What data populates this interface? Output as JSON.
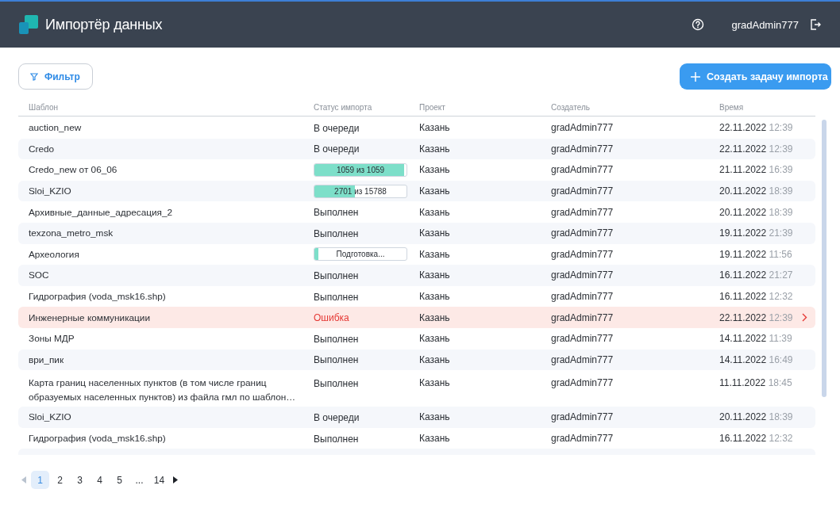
{
  "header": {
    "title": "Импортёр данных",
    "user": "gradAdmin777"
  },
  "toolbar": {
    "filter": "Фильтр",
    "create": "Создать задачу импорта"
  },
  "table": {
    "columns": [
      "Шаблон",
      "Статус импорта",
      "Проект",
      "Создатель",
      "Время"
    ],
    "rows": [
      {
        "template": "auction_new",
        "status": {
          "kind": "text",
          "label": "В очереди"
        },
        "project": "Казань",
        "creator": "gradAdmin777",
        "date": "22.11.2022",
        "time": "12:39",
        "selected": false
      },
      {
        "template": "Credo",
        "status": {
          "kind": "text",
          "label": "В очереди"
        },
        "project": "Казань",
        "creator": "gradAdmin777",
        "date": "22.11.2022",
        "time": "12:39",
        "selected": false
      },
      {
        "template": "Credo_new от 06_06",
        "status": {
          "kind": "progress",
          "label": "1059 из 1059",
          "level": 0.97
        },
        "project": "Казань",
        "creator": "gradAdmin777",
        "date": "21.11.2022",
        "time": "16:39",
        "selected": false
      },
      {
        "template": "Sloi_KZIO",
        "status": {
          "kind": "progress",
          "label": "2701 из 15788",
          "level": 0.44
        },
        "project": "Казань",
        "creator": "gradAdmin777",
        "date": "20.11.2022",
        "time": "18:39",
        "selected": false
      },
      {
        "template": "Архивные_данные_адресация_2",
        "status": {
          "kind": "text",
          "label": "Выполнен"
        },
        "project": "Казань",
        "creator": "gradAdmin777",
        "date": "20.11.2022",
        "time": "18:39",
        "selected": false
      },
      {
        "template": "texzona_metro_msk",
        "status": {
          "kind": "text",
          "label": "Выполнен"
        },
        "project": "Казань",
        "creator": "gradAdmin777",
        "date": "19.11.2022",
        "time": "21:39",
        "selected": false
      },
      {
        "template": "Археология",
        "status": {
          "kind": "progress",
          "label": "Подготовка...",
          "level": 0.04
        },
        "project": "Казань",
        "creator": "gradAdmin777",
        "date": "19.11.2022",
        "time": "11:56",
        "selected": false
      },
      {
        "template": "SOC",
        "status": {
          "kind": "text",
          "label": "Выполнен"
        },
        "project": "Казань",
        "creator": "gradAdmin777",
        "date": "16.11.2022",
        "time": "21:27",
        "selected": false
      },
      {
        "template": "Гидрография (voda_msk16.shp)",
        "status": {
          "kind": "text",
          "label": "Выполнен"
        },
        "project": "Казань",
        "creator": "gradAdmin777",
        "date": "16.11.2022",
        "time": "12:32",
        "selected": false
      },
      {
        "template": "Инженерные коммуникации",
        "status": {
          "kind": "error",
          "label": "Ошибка"
        },
        "project": "Казань",
        "creator": "gradAdmin777",
        "date": "22.11.2022",
        "time": "12:39",
        "selected": true
      },
      {
        "template": "Зоны МДР",
        "status": {
          "kind": "text",
          "label": "Выполнен"
        },
        "project": "Казань",
        "creator": "gradAdmin777",
        "date": "14.11.2022",
        "time": "11:39",
        "selected": false
      },
      {
        "template": "ври_пик",
        "status": {
          "kind": "text",
          "label": "Выполнен"
        },
        "project": "Казань",
        "creator": "gradAdmin777",
        "date": "14.11.2022",
        "time": "16:49",
        "selected": false
      },
      {
        "template": "Карта границ населенных пунктов (в том числе границ образуемых населенных пунктов) из файла гмл по шаблон…",
        "status": {
          "kind": "text",
          "label": "Выполнен"
        },
        "project": "Казань",
        "creator": "gradAdmin777",
        "date": "11.11.2022",
        "time": "18:45",
        "selected": false
      },
      {
        "template": "Sloi_KZIO",
        "status": {
          "kind": "text",
          "label": "В очереди"
        },
        "project": "Казань",
        "creator": "gradAdmin777",
        "date": "20.11.2022",
        "time": "18:39",
        "selected": false
      },
      {
        "template": "Гидрография (voda_msk16.shp)",
        "status": {
          "kind": "text",
          "label": "Выполнен"
        },
        "project": "Казань",
        "creator": "gradAdmin777",
        "date": "16.11.2022",
        "time": "12:32",
        "selected": false
      }
    ]
  },
  "pagination": {
    "pages": [
      {
        "label": "1",
        "selected": true
      },
      {
        "label": "2",
        "selected": false
      },
      {
        "label": "3",
        "selected": false
      },
      {
        "label": "4",
        "selected": false
      },
      {
        "label": "5",
        "selected": false
      },
      {
        "label": "...",
        "selected": false
      },
      {
        "label": "14",
        "selected": false
      }
    ],
    "prev_disabled": true,
    "next_disabled": false
  }
}
